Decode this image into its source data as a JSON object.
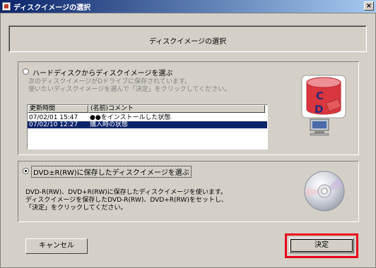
{
  "window": {
    "title": "ディスクイメージの選択",
    "close_label": "×"
  },
  "header": {
    "title": "ディスクイメージの選択"
  },
  "option_hdd": {
    "label": "ハードディスクからディスクイメージを選ぶ",
    "desc_line1": "次のディスクイメージがDドライブに保存されています。",
    "desc_line2": "使いたいディスクイメージを選んで「決定」をクリックしてください。",
    "selected": false
  },
  "list": {
    "columns": [
      "更新時間",
      "(名前)コメント"
    ],
    "rows": [
      {
        "time": "07/02/01 15:47",
        "comment": "●●をインストールした状態",
        "selected": false
      },
      {
        "time": "07/02/10 12:27",
        "comment": "購入時の状態",
        "selected": true
      }
    ]
  },
  "option_dvd": {
    "label": "DVD±R(RW)に保存したディスクイメージを選ぶ",
    "desc_line1": "DVD-R(RW)、DVD+R(RW)に保存したディスクイメージを使います。",
    "desc_line2": "ディスクイメージを保存したDVD-R(RW)、DVD+R(RW)をセットし、",
    "desc_line3": "「決定」をクリックしてください。",
    "selected": true
  },
  "icons": {
    "cd_icon": "cd-database-computer-icon",
    "dvd_icon": "dvd-disc-icon"
  },
  "buttons": {
    "cancel": "キャンセル",
    "ok": "決定"
  },
  "colors": {
    "highlight": "#0a246a",
    "annotation_border": "#e8001c",
    "title_gradient_start": "#0a246a"
  }
}
